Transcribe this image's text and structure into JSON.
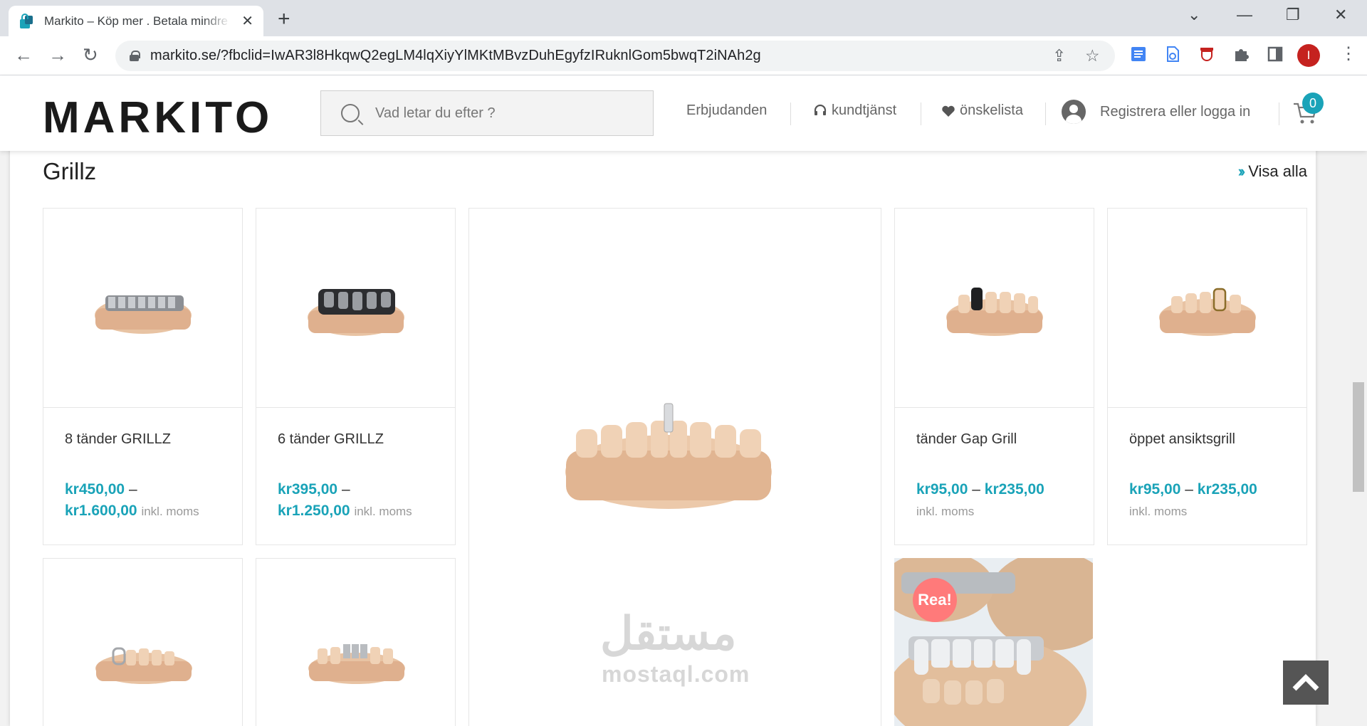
{
  "browser": {
    "tab_title": "Markito – Köp mer . Betala mindre",
    "url": "markito.se/?fbclid=IwAR3l8HkqwQ2egLM4lqXiyYlMKtMBvzDuhEgyfzIRuknlGom5bwqT2iNAh2g",
    "profile_initial": "I"
  },
  "header": {
    "logo": "MARKITO",
    "search_placeholder": "Vad letar du efter ?",
    "nav": {
      "offers": "Erbjudanden",
      "support": "kundtjänst",
      "wishlist": "önskelista",
      "account": "Registrera eller logga in"
    },
    "cart_count": "0"
  },
  "section": {
    "title": "Grillz",
    "view_all": "Visa alla"
  },
  "products": [
    {
      "name": "8 tänder GRILLZ",
      "price_from": "kr450,00",
      "price_to": "kr1.600,00",
      "tax_note": "inkl. moms"
    },
    {
      "name": "6 tänder GRILLZ",
      "price_from": "kr395,00",
      "price_to": "kr1.250,00",
      "tax_note": "inkl. moms"
    },
    {
      "name": "tänder Gap Grill",
      "price_from": "kr95,00",
      "price_to": "kr235,00",
      "tax_note": "inkl. moms"
    },
    {
      "name": "öppet ansiktsgrill",
      "price_from": "kr95,00",
      "price_to": "kr235,00",
      "tax_note": "inkl. moms"
    }
  ],
  "sale_badge": "Rea!",
  "watermark": {
    "arabic": "مستقل",
    "latin": "mostaql.com"
  },
  "colors": {
    "accent": "#1aa3b8",
    "sale": "#ff7a7a",
    "tooth_model": "#e8c3a3"
  }
}
